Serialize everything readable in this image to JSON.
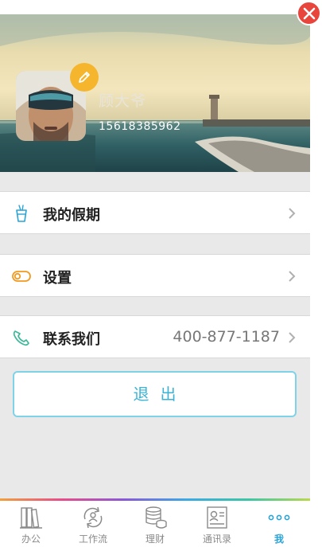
{
  "profile": {
    "name": "顾大爷",
    "phone": "15618385962"
  },
  "menu": {
    "vacation": {
      "label": "我的假期",
      "icon": "cup-icon"
    },
    "settings": {
      "label": "设置",
      "icon": "toggle-icon"
    },
    "contact": {
      "label": "联系我们",
      "value": "400-877-1187",
      "icon": "phone-icon"
    }
  },
  "logout_label": "退出",
  "tabbar": {
    "tabs": [
      {
        "label": "办公",
        "icon": "books-icon"
      },
      {
        "label": "工作流",
        "icon": "workflow-icon"
      },
      {
        "label": "理财",
        "icon": "coins-icon"
      },
      {
        "label": "通讯录",
        "icon": "contact-card-icon"
      },
      {
        "label": "我",
        "icon": "more-dots-icon",
        "active": true
      }
    ]
  },
  "colors": {
    "accent": "#2aa3d6",
    "close": "#e8453c",
    "edit_badge": "#f5b62e",
    "toggle_icon": "#f29a1f",
    "phone_icon": "#3fb89a"
  }
}
